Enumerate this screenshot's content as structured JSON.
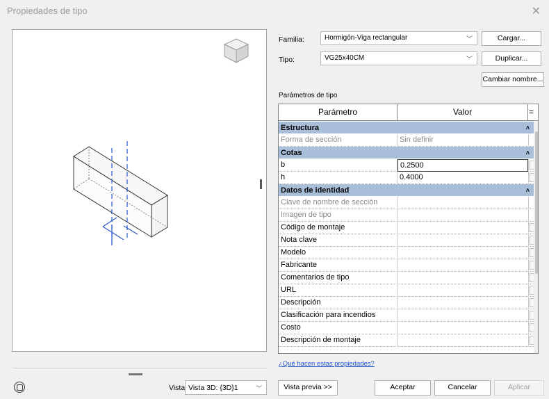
{
  "window": {
    "title": "Propiedades de tipo",
    "close_glyph": "✕"
  },
  "family": {
    "label": "Familia:",
    "value": "Hormigón-Viga rectangular"
  },
  "type": {
    "label": "Tipo:",
    "value": "VG25x40CM"
  },
  "buttons": {
    "load": "Cargar...",
    "duplicate": "Duplicar...",
    "rename": "Cambiar nombre...",
    "preview": "Vista previa >>",
    "accept": "Aceptar",
    "cancel": "Cancelar",
    "apply": "Aplicar"
  },
  "params_label": "Parámetros de tipo",
  "grid": {
    "col_param": "Parámetro",
    "col_value": "Valor",
    "col_eq": "=",
    "groups": [
      {
        "name": "Estructura",
        "caret": "˄",
        "rows": [
          {
            "param": "Forma de sección",
            "value": "Sin definir",
            "readonly": true
          }
        ]
      },
      {
        "name": "Cotas",
        "caret": "˄",
        "rows": [
          {
            "param": "b",
            "value": "0.2500"
          },
          {
            "param": "h",
            "value": "0.4000"
          }
        ]
      },
      {
        "name": "Datos de identidad",
        "caret": "˄",
        "rows": [
          {
            "param": "Clave de nombre de sección",
            "value": "",
            "readonly": true
          },
          {
            "param": "Imagen de tipo",
            "value": "",
            "readonly": true
          },
          {
            "param": "Código de montaje",
            "value": ""
          },
          {
            "param": "Nota clave",
            "value": ""
          },
          {
            "param": "Modelo",
            "value": ""
          },
          {
            "param": "Fabricante",
            "value": ""
          },
          {
            "param": "Comentarios de tipo",
            "value": ""
          },
          {
            "param": "URL",
            "value": ""
          },
          {
            "param": "Descripción",
            "value": ""
          },
          {
            "param": "Clasificación para incendios",
            "value": ""
          },
          {
            "param": "Costo",
            "value": ""
          },
          {
            "param": "Descripción de montaje",
            "value": ""
          }
        ]
      }
    ]
  },
  "help_link": "¿Qué hacen estas propiedades?",
  "view": {
    "label": "Vista:",
    "value": "Vista 3D: {3D}1"
  },
  "icons": {
    "dropdown": "chevron-down-icon",
    "view_cube": "view-cube-icon",
    "steering": "steering-wheel-icon"
  }
}
